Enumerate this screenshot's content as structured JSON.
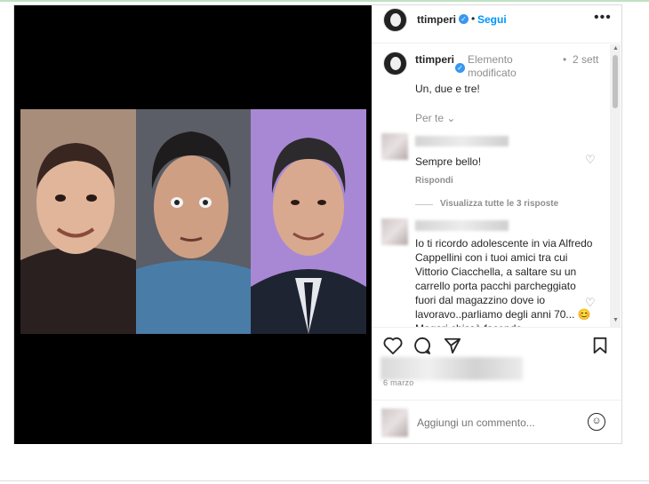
{
  "post": {
    "header": {
      "username": "ttimperi",
      "verified_icon": "verified-badge-icon",
      "separator": "•",
      "follow_label": "Segui",
      "more_icon": "more-options-icon",
      "more_glyph": "•••"
    },
    "caption": {
      "username": "ttimperi",
      "edited": "Elemento modificato",
      "separator": "•",
      "time": "2 sett",
      "text": "Un, due e tre!",
      "translate_link": "Per te"
    },
    "comments": [
      {
        "text": "Sempre bello!",
        "reply_label": "Rispondi",
        "view_replies": "Visualizza tutte le 3 risposte"
      },
      {
        "text": "Io ti ricordo adolescente in via Alfredo Cappellini con i tuoi amici tra cui Vittorio Ciacchella, a saltare su un carrello porta pacchi parcheggiato fuori dal magazzino dove io lavoravo..parliamo degli anni 70... 😊 Magari chissà facendo"
      }
    ],
    "actions": {
      "like_icon": "heart-icon",
      "comment_icon": "comment-icon",
      "share_icon": "share-icon",
      "save_icon": "bookmark-icon"
    },
    "date": "6 marzo",
    "add_comment": {
      "placeholder": "Aggiungi un commento...",
      "emoji_icon": "emoji-icon"
    }
  },
  "colors": {
    "accent": "#0095f6",
    "verified": "#3897f0",
    "text": "#262626",
    "muted": "#8e8e8e"
  }
}
